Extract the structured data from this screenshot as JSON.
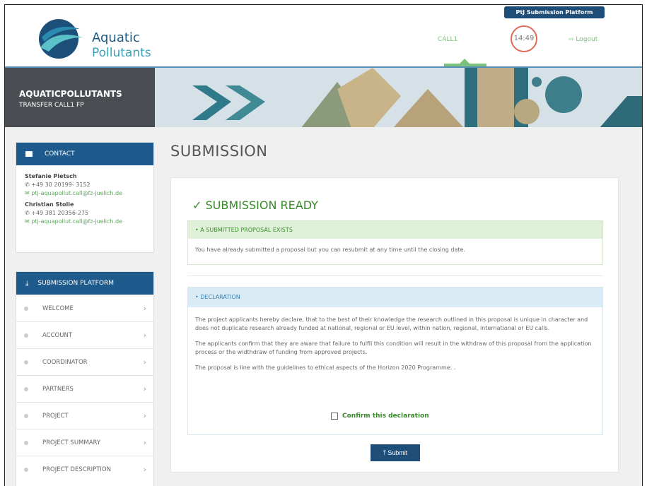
{
  "header": {
    "logo_line1": "Aquatic",
    "logo_line2": "Pollutants",
    "platform_tag": "PtJ Submission Platform",
    "nav_call": "CALL1",
    "timer": "14:49",
    "logout": "Logout"
  },
  "banner": {
    "title": "AQUATICPOLLUTANTS",
    "subtitle": "TRANSFER CALL1 FP"
  },
  "contact": {
    "heading": "CONTACT",
    "people": [
      {
        "name": "Stefanie Pietsch",
        "phone": "+49 30 20199- 3152",
        "email": "ptj-aquapollut.call@fz-juelich.de"
      },
      {
        "name": "Christian Stolle",
        "phone": "+49 381 20356-275",
        "email": "ptj-aquapollut.call@fz-juelich.de"
      }
    ]
  },
  "menu": {
    "heading": "SUBMISSION PLATFORM",
    "items": [
      "WELCOME",
      "ACCOUNT",
      "COORDINATOR",
      "PARTNERS",
      "PROJECT",
      "PROJECT SUMMARY",
      "PROJECT DESCRIPTION"
    ]
  },
  "main": {
    "page_title": "SUBMISSION",
    "ready_title": "SUBMISSION READY",
    "exists_head": "A SUBMITTED PROPOSAL EXISTS",
    "exists_body": "You have already submitted a proposal but you can resubmit at any time until the closing date.",
    "declaration_head": "DECLARATION",
    "declaration_p1": "The project applicants hereby declare, that to the best of their knowledge the research outlined in this proposal is unique in character and does not duplicate research already funded at national, regional or EU level, within nation, regional, international or EU calls.",
    "declaration_p2": "The applicants confirm that they are aware that failure to fulfil this condition will result in the withdraw of this proposal from the application process or the widthdraw of funding from approved projects.",
    "declaration_p3": "The proposal is line with the guidelines to ethical aspects of the Horizon 2020 Programme: .",
    "confirm_label": "Confirm this declaration",
    "submit_label": "Submit"
  },
  "colors": {
    "primary": "#1e5a8c",
    "accent_green": "#7cc17c",
    "success": "#3a8a2a",
    "timer_ring": "#e26a5a"
  }
}
